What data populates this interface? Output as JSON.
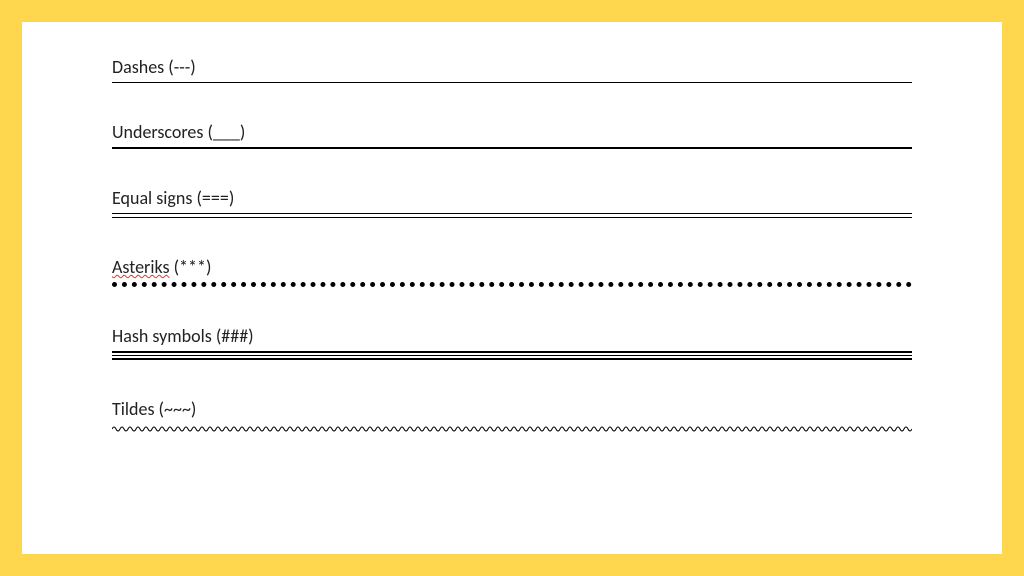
{
  "lines": [
    {
      "label_plain": "Dashes (---)",
      "style": "dashes"
    },
    {
      "label_plain": "Underscores (___)",
      "style": "underscores"
    },
    {
      "label_plain": "Equal signs (===)",
      "style": "equals"
    },
    {
      "label_prefix_misspelled": "Asteriks",
      "label_suffix": " (***)",
      "style": "asterisks"
    },
    {
      "label_plain": "Hash symbols (###)",
      "style": "hash"
    },
    {
      "label_plain": "Tildes (~~~)",
      "style": "tildes"
    }
  ],
  "border_color": "#ffd74f",
  "page_background": "#ffffff"
}
